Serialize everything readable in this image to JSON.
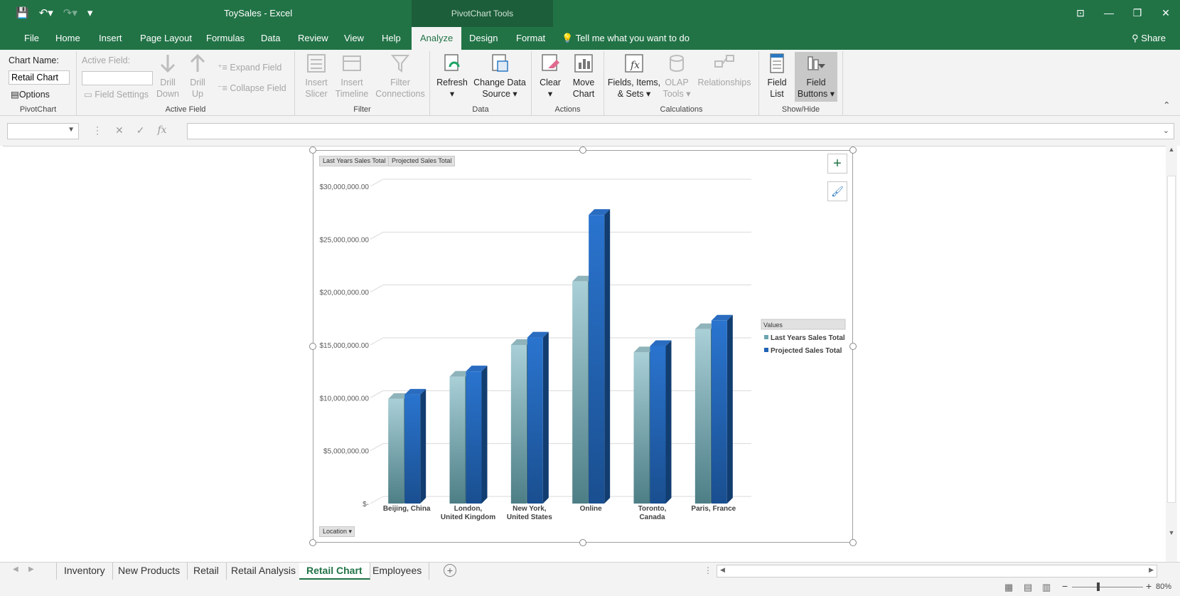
{
  "titlebar": {
    "doc_title": "ToySales  -  Excel",
    "context_label": "PivotChart Tools"
  },
  "tabs": [
    "File",
    "Home",
    "Insert",
    "Page Layout",
    "Formulas",
    "Data",
    "Review",
    "View",
    "Help",
    "Analyze",
    "Design",
    "Format"
  ],
  "tell_me": "Tell me what you want to do",
  "share": "Share",
  "ribbon": {
    "pivotchart": {
      "chart_name_label": "Chart Name:",
      "chart_name_value": "Retail Chart",
      "options": "Options",
      "group": "PivotChart"
    },
    "active_field": {
      "label": "Active Field:",
      "field_settings": "Field Settings",
      "drill_down_1": "Drill",
      "drill_down_2": "Down",
      "drill_up_1": "Drill",
      "drill_up_2": "Up",
      "expand": "Expand Field",
      "collapse": "Collapse Field",
      "group": "Active Field"
    },
    "filter": {
      "slicer_1": "Insert",
      "slicer_2": "Slicer",
      "timeline_1": "Insert",
      "timeline_2": "Timeline",
      "conn_1": "Filter",
      "conn_2": "Connections",
      "group": "Filter"
    },
    "data": {
      "refresh": "Refresh",
      "change_1": "Change Data",
      "change_2": "Source",
      "group": "Data"
    },
    "actions": {
      "clear": "Clear",
      "move_1": "Move",
      "move_2": "Chart",
      "group": "Actions"
    },
    "calculations": {
      "fields_1": "Fields, Items,",
      "fields_2": "& Sets",
      "olap_1": "OLAP",
      "olap_2": "Tools",
      "relationships": "Relationships",
      "group": "Calculations"
    },
    "showhide": {
      "fieldlist_1": "Field",
      "fieldlist_2": "List",
      "fieldbuttons_1": "Field",
      "fieldbuttons_2": "Buttons",
      "group": "Show/Hide"
    }
  },
  "sheet_tabs": [
    "Inventory",
    "New Products",
    "Retail",
    "Retail Analysis",
    "Retail Chart",
    "Employees"
  ],
  "active_sheet": "Retail Chart",
  "zoom": "80%",
  "chart_buttons": {
    "series1": "Last Years Sales Total",
    "series2": "Projected Sales Total",
    "legend_title": "Values",
    "axis_field": "Location"
  },
  "colors": {
    "excel_green": "#217346",
    "series1": "#6aa5b0",
    "series2": "#1f63b5"
  },
  "chart_data": {
    "type": "bar",
    "categories": [
      "Beijing, China",
      "London, United Kingdom",
      "New York, United States",
      "Online",
      "Toronto, Canada",
      "Paris, France"
    ],
    "series": [
      {
        "name": "Last Years Sales Total",
        "values": [
          9900000,
          12000000,
          15000000,
          21000000,
          14300000,
          16500000
        ]
      },
      {
        "name": "Projected Sales Total",
        "values": [
          10300000,
          12500000,
          15700000,
          27300000,
          14900000,
          17300000
        ]
      }
    ],
    "yticks": [
      "$-",
      "$5,000,000.00",
      "$10,000,000.00",
      "$15,000,000.00",
      "$20,000,000.00",
      "$25,000,000.00",
      "$30,000,000.00"
    ],
    "ylim": [
      0,
      30000000
    ],
    "legend_position": "right",
    "grid": true
  }
}
